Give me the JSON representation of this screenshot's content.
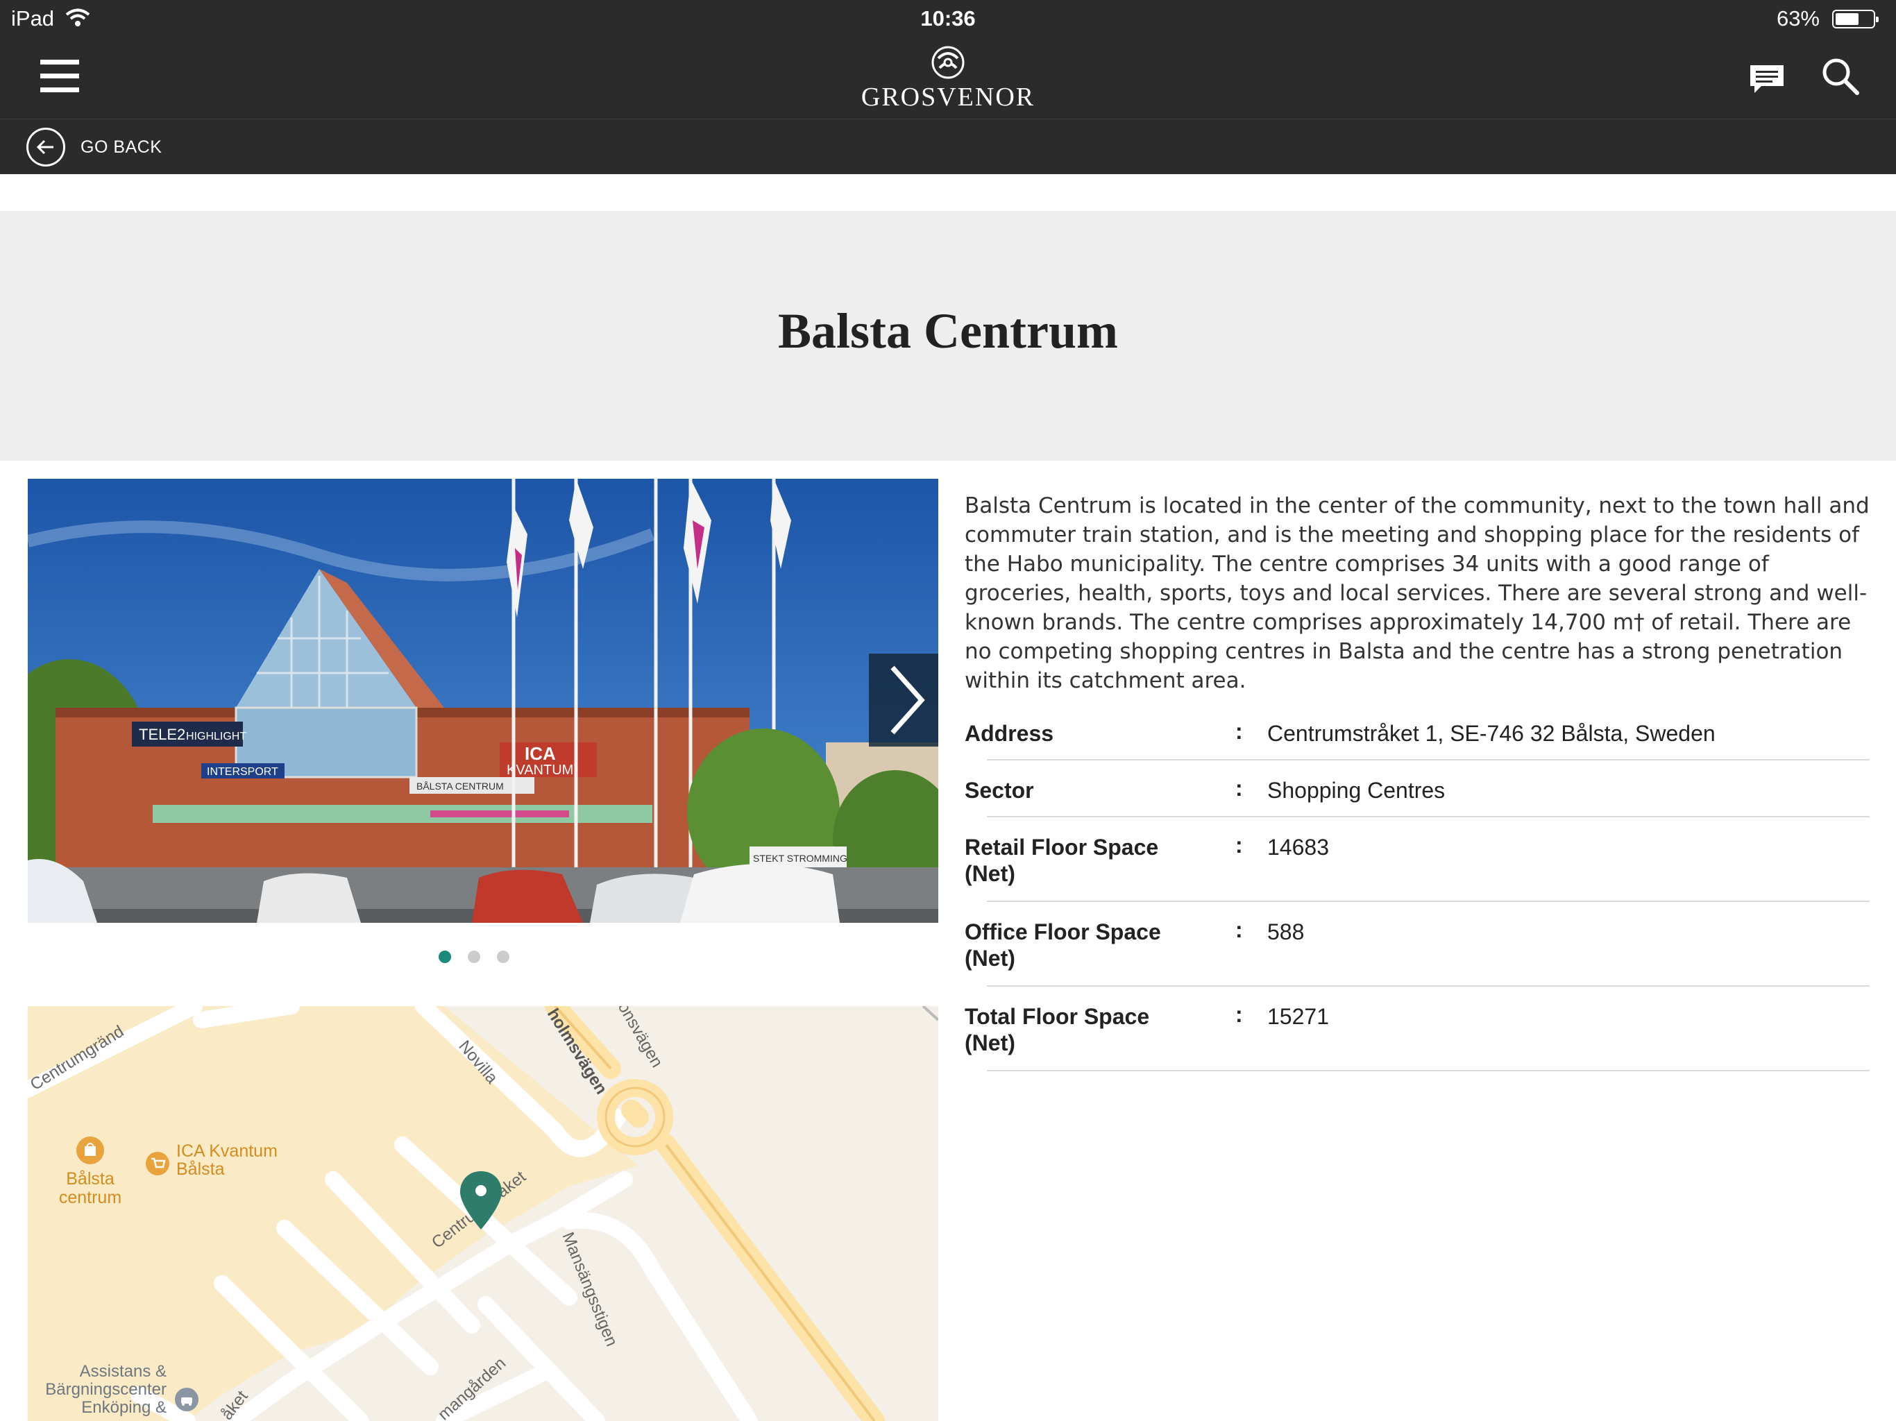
{
  "status_bar": {
    "device": "iPad",
    "time": "10:36",
    "battery": "63%",
    "battery_level": 0.63
  },
  "header": {
    "logo_text": "GROSVENOR",
    "go_back": "GO BACK"
  },
  "page": {
    "title": "Balsta Centrum",
    "description": "Balsta Centrum is located in the center of the community, next to the town hall and commuter train station, and is the meeting and shopping place for the residents of the Habo municipality. The centre comprises 34 units with a good range of groceries, health, sports, toys and local services.  There are several strong and well-known brands. The centre comprises approximately 14,700 m† of retail. There are no competing shopping centres in Balsta and the centre has a strong penetration within its catchment area."
  },
  "carousel": {
    "active_index": 0,
    "count": 3,
    "photo_signs": [
      "TELE2",
      "HIGHLIGHT",
      "INTERSPORT",
      "ICA",
      "KVANTUM",
      "BÅLSTA CENTRUM",
      "STEKT STROMMING"
    ]
  },
  "details": [
    {
      "label": "Address",
      "value": "Centrumstråket 1, SE-746 32 Bålsta, Sweden"
    },
    {
      "label": "Sector",
      "value": "Shopping Centres"
    },
    {
      "label": "Retail Floor Space (Net)",
      "value": "14683"
    },
    {
      "label": "Office Floor Space (Net)",
      "value": "588"
    },
    {
      "label": "Total Floor Space (Net)",
      "value": "15271"
    }
  ],
  "map": {
    "streets": [
      "Centrumgränd",
      "Novilla",
      "holmsvägen",
      "onsvägen",
      "Centrumstråket",
      "Mansängsstigen",
      "mangården",
      "åket"
    ],
    "pois": [
      {
        "name": "Bålsta centrum",
        "line1": "Bålsta",
        "line2": "centrum",
        "icon": "shopping-bag-icon"
      },
      {
        "name": "ICA Kvantum Bålsta",
        "line1": "ICA Kvantum",
        "line2": "Bålsta",
        "icon": "cart-icon"
      },
      {
        "name": "Assistans & Bärgningscenter Enköping &",
        "line1": "Assistans &",
        "line2": "Bärgningscenter",
        "line3": "Enköping &",
        "icon": "car-icon"
      }
    ],
    "colors": {
      "land": "#f4efe7",
      "block": "#faebc6",
      "road": "#ffffff",
      "main_road": "#fde3a7",
      "pin": "#2e7d6b",
      "poi": "#e8a33d"
    }
  },
  "colors": {
    "header_bg": "#2b2b2b",
    "title_band": "#eeeeee",
    "accent_dot": "#1b8a7a"
  }
}
